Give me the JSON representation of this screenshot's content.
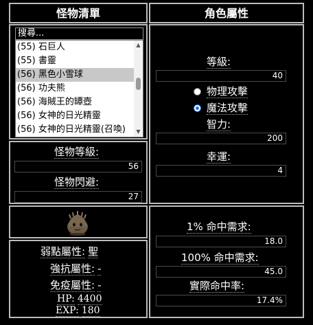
{
  "monster_list": {
    "header": "怪物清單",
    "search_placeholder": "搜尋...",
    "items": [
      "(55) 石巨人",
      "(55) 書靈",
      "(56) 黑色小雪球",
      "(56) 功夫熊",
      "(56) 海賊王的罈壺",
      "(56) 女神的日光精靈",
      "(56) 女神的日光精靈(召喚)"
    ],
    "selected_index": 2
  },
  "monster_stats": {
    "level_label": "怪物等級:",
    "level_value": "56",
    "avoid_label": "怪物閃避:",
    "avoid_value": "27"
  },
  "monster_image": {
    "icon": "dark-snowball-monster-icon"
  },
  "monster_info": {
    "weakness_label": "弱點屬性:",
    "weakness_value": "聖",
    "resist_label": "強抗屬性:",
    "resist_value": "-",
    "immune_label": "免疫屬性:",
    "immune_value": "-",
    "hp_label": "HP:",
    "hp_value": "4400",
    "exp_label": "EXP:",
    "exp_value": "180"
  },
  "character": {
    "header": "角色屬性",
    "level_label": "等級:",
    "level_value": "40",
    "physical_label": "物理攻擊",
    "magic_label": "魔法攻擊",
    "selected_attack": "magic",
    "int_label": "智力:",
    "int_value": "200",
    "luk_label": "幸運:",
    "luk_value": "4"
  },
  "accuracy": {
    "one_pct_label": "1% 命中需求:",
    "one_pct_value": "18.0",
    "hundred_pct_label": "100% 命中需求:",
    "hundred_pct_value": "45.0",
    "actual_label": "實際命中率:",
    "actual_value": "17.4%"
  },
  "colors": {
    "background": "#000000",
    "border": "#bdbdbd",
    "radio_accent": "#1a73e8",
    "list_selected": "#c8c8c8"
  }
}
